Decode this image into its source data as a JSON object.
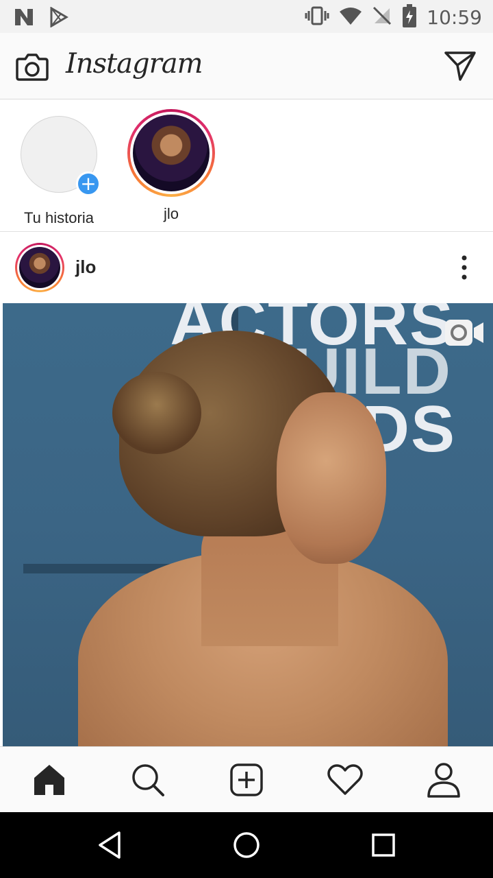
{
  "status_bar": {
    "time": "10:59",
    "left_icons": [
      "n-notification-icon",
      "play-store-icon"
    ],
    "right_icons": [
      "vibrate-icon",
      "wifi-icon",
      "no-sim-icon",
      "battery-icon"
    ]
  },
  "app_bar": {
    "title": "Instagram",
    "left_icon": "camera-icon",
    "right_icon": "direct-message-icon"
  },
  "stories": [
    {
      "label": "Tu historia",
      "is_own": true
    },
    {
      "label": "jlo",
      "is_own": false
    }
  ],
  "post": {
    "username": "jlo",
    "media_text": [
      "ACTORS",
      "GUILD",
      "RDS"
    ],
    "media_type_icon": "video-icon",
    "more_icon": "more-vertical-icon"
  },
  "tab_bar": {
    "items": [
      "home-icon",
      "search-icon",
      "new-post-icon",
      "heart-icon",
      "profile-icon"
    ],
    "active": "home-icon"
  },
  "nav_bar": {
    "items": [
      "back-icon",
      "home-circle-icon",
      "recents-icon"
    ]
  },
  "colors": {
    "story_ring_start": "#c2185b",
    "story_ring_end": "#fcaf45",
    "add_story_badge": "#3897f0",
    "text_primary": "#262626"
  }
}
